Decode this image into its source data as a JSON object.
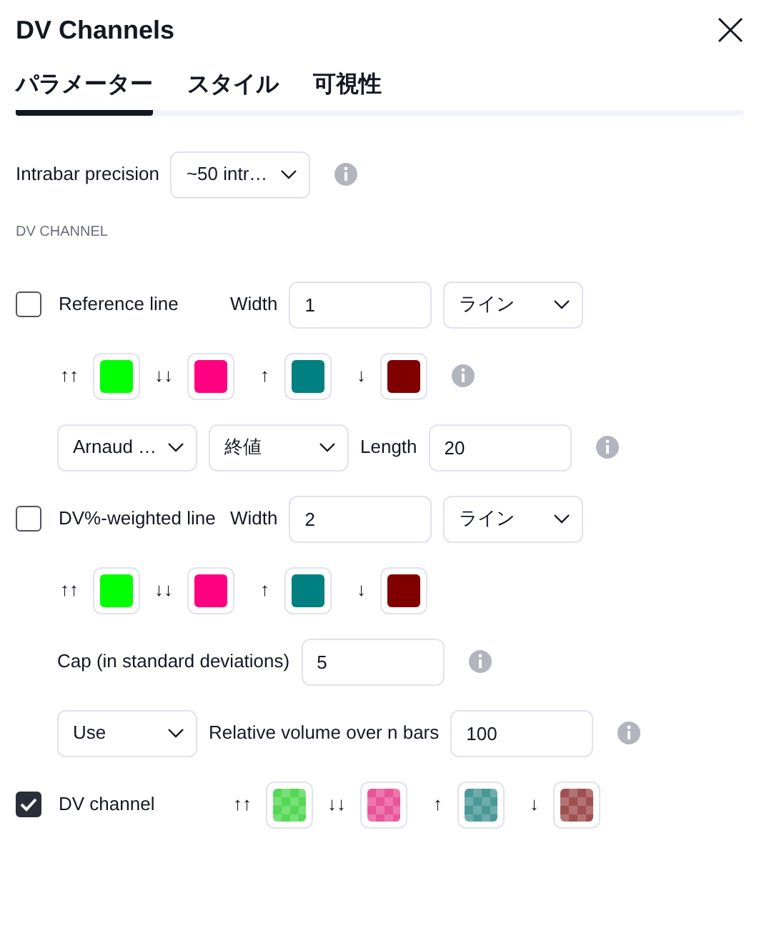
{
  "title": "DV Channels",
  "tabs": [
    {
      "label": "パラメーター",
      "selected": true
    },
    {
      "label": "スタイル",
      "selected": false
    },
    {
      "label": "可視性",
      "selected": false
    }
  ],
  "rows": [
    {
      "kind": "fields",
      "items": [
        {
          "kind": "label",
          "text": "Intrabar precision"
        },
        {
          "kind": "select",
          "value": "~50 intr…"
        },
        {
          "kind": "info"
        }
      ]
    },
    {
      "kind": "section",
      "text": "DV CHANNEL"
    },
    {
      "kind": "line",
      "checkbox": {
        "label": "Reference line",
        "checked": false
      },
      "items": [
        {
          "kind": "label",
          "text": "Width"
        },
        {
          "kind": "input",
          "value": "1"
        },
        {
          "kind": "select",
          "value": "ライン"
        }
      ],
      "children": [
        {
          "kind": "fields",
          "items": [
            {
              "kind": "arrow",
              "text": "↑↑"
            },
            {
              "kind": "swatch",
              "color": "#00ff00",
              "translucent": false
            },
            {
              "kind": "arrow",
              "text": "↓↓"
            },
            {
              "kind": "swatch",
              "color": "#ff0080",
              "translucent": false
            },
            {
              "kind": "arrow",
              "text": "↑"
            },
            {
              "kind": "swatch",
              "color": "#008080",
              "translucent": false
            },
            {
              "kind": "arrow",
              "text": "↓"
            },
            {
              "kind": "swatch",
              "color": "#800000",
              "translucent": false
            },
            {
              "kind": "info"
            }
          ]
        },
        {
          "kind": "fields",
          "items": [
            {
              "kind": "select",
              "value": "Arnaud …"
            },
            {
              "kind": "select",
              "value": "終値"
            },
            {
              "kind": "label",
              "text": "Length"
            },
            {
              "kind": "input",
              "value": "20"
            },
            {
              "kind": "info"
            }
          ]
        }
      ]
    },
    {
      "kind": "line",
      "checkbox": {
        "label": "DV%-weighted line",
        "checked": false
      },
      "items": [
        {
          "kind": "label",
          "text": "Width"
        },
        {
          "kind": "input",
          "value": "2"
        },
        {
          "kind": "select",
          "value": "ライン"
        }
      ],
      "children": [
        {
          "kind": "fields",
          "items": [
            {
              "kind": "arrow",
              "text": "↑↑"
            },
            {
              "kind": "swatch",
              "color": "#00ff00",
              "translucent": false
            },
            {
              "kind": "arrow",
              "text": "↓↓"
            },
            {
              "kind": "swatch",
              "color": "#ff0080",
              "translucent": false
            },
            {
              "kind": "arrow",
              "text": "↑"
            },
            {
              "kind": "swatch",
              "color": "#008080",
              "translucent": false
            },
            {
              "kind": "arrow",
              "text": "↓"
            },
            {
              "kind": "swatch",
              "color": "#800000",
              "translucent": false
            }
          ]
        },
        {
          "kind": "fields",
          "items": [
            {
              "kind": "label",
              "text": "Cap (in standard deviations)"
            },
            {
              "kind": "input",
              "value": "5"
            },
            {
              "kind": "info"
            }
          ]
        },
        {
          "kind": "fields",
          "items": [
            {
              "kind": "select",
              "value": "Use"
            },
            {
              "kind": "label",
              "text": "Relative volume over n bars"
            },
            {
              "kind": "input",
              "value": "100"
            },
            {
              "kind": "info"
            }
          ]
        }
      ]
    },
    {
      "kind": "line",
      "checkbox": {
        "label": "DV channel",
        "checked": true
      },
      "items": [
        {
          "kind": "arrow",
          "text": "↑↑"
        },
        {
          "kind": "swatch",
          "color": "#55d855",
          "translucent": true
        },
        {
          "kind": "arrow",
          "text": "↓↓"
        },
        {
          "kind": "swatch",
          "color": "#e8559a",
          "translucent": true
        },
        {
          "kind": "arrow",
          "text": "↑"
        },
        {
          "kind": "swatch",
          "color": "#4a9898",
          "translucent": true
        },
        {
          "kind": "arrow",
          "text": "↓"
        },
        {
          "kind": "swatch",
          "color": "#a05050",
          "translucent": true
        }
      ]
    }
  ]
}
